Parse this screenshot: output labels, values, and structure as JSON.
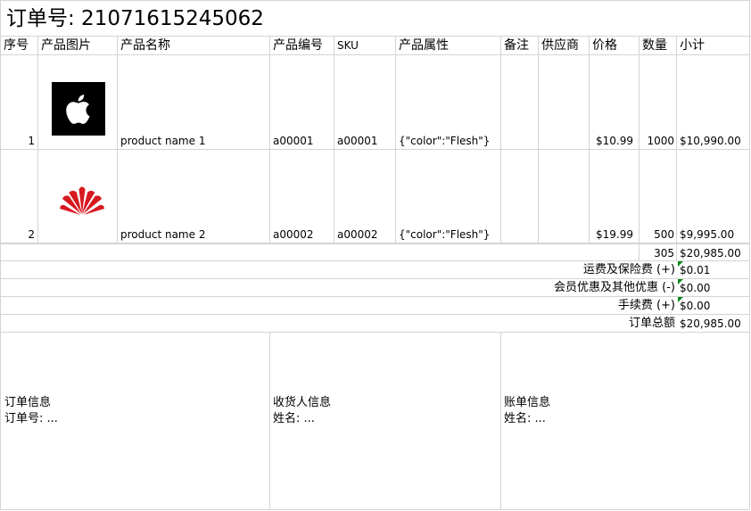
{
  "title": "订单号: 21071615245062",
  "headers": {
    "index": "序号",
    "image": "产品图片",
    "name": "产品名称",
    "code": "产品编号",
    "sku": "SKU",
    "attrs": "产品属性",
    "note": "备注",
    "supplier": "供应商",
    "price": "价格",
    "qty": "数量",
    "subtotal": "小计"
  },
  "rows": [
    {
      "index": "1",
      "logo": "apple-logo-icon",
      "name": "product name 1",
      "code": "a00001",
      "sku": "a00001",
      "attrs": "{\"color\":\"Flesh\"}",
      "note": "",
      "supplier": "",
      "price": "$10.99",
      "qty": "1000",
      "subtotal": "$10,990.00"
    },
    {
      "index": "2",
      "logo": "huawei-logo-icon",
      "name": "product name 2",
      "code": "a00002",
      "sku": "a00002",
      "attrs": "{\"color\":\"Flesh\"}",
      "note": "",
      "supplier": "",
      "price": "$19.99",
      "qty": "500",
      "subtotal": "$9,995.00"
    }
  ],
  "totals": {
    "qty": "305",
    "subtotal": "$20,985.00"
  },
  "summary": [
    {
      "label": "运费及保险费 (+)",
      "value": "$0.01",
      "flag": true
    },
    {
      "label": "会员优惠及其他优惠 (-)",
      "value": "$0.00",
      "flag": true
    },
    {
      "label": "手续费 (+)",
      "value": "$0.00",
      "flag": true
    },
    {
      "label": "订单总额",
      "value": "$20,985.00",
      "flag": false
    }
  ],
  "info": {
    "order": {
      "title": "订单信息",
      "line": "订单号: ..."
    },
    "recipient": {
      "title": "收货人信息",
      "line": "姓名: ..."
    },
    "billing": {
      "title": "账单信息",
      "line": "姓名: ..."
    }
  },
  "colors": {
    "grid": "#d4d4d4",
    "huawei_red": "#d71920",
    "flag_green": "#0b8a1e"
  }
}
